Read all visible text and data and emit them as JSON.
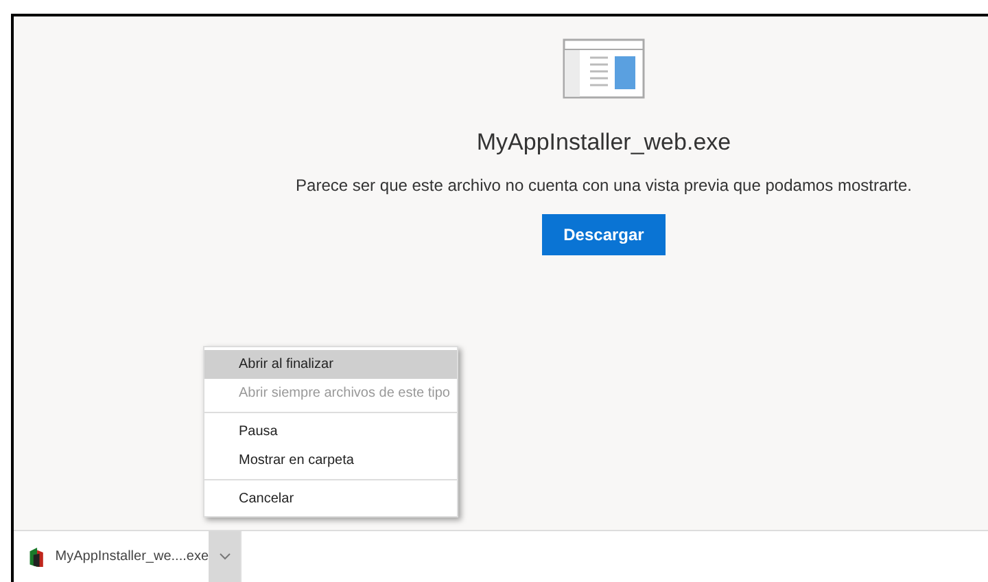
{
  "preview": {
    "filename": "MyAppInstaller_web.exe",
    "message": "Parece ser que este archivo no cuenta con una vista previa que podamos mostrarte.",
    "button": "Descargar"
  },
  "context_menu": {
    "items": [
      {
        "kind": "item",
        "label": "Abrir al finalizar",
        "selected": true,
        "disabled": false
      },
      {
        "kind": "item",
        "label": "Abrir siempre archivos de este tipo",
        "selected": false,
        "disabled": true
      },
      {
        "kind": "separator"
      },
      {
        "kind": "item",
        "label": "Pausa",
        "selected": false,
        "disabled": false
      },
      {
        "kind": "item",
        "label": "Mostrar en carpeta",
        "selected": false,
        "disabled": false
      },
      {
        "kind": "separator"
      },
      {
        "kind": "item",
        "label": "Cancelar",
        "selected": false,
        "disabled": false
      }
    ]
  },
  "download_bar": {
    "filename": "MyAppInstaller_we....exe",
    "expanded": true
  }
}
